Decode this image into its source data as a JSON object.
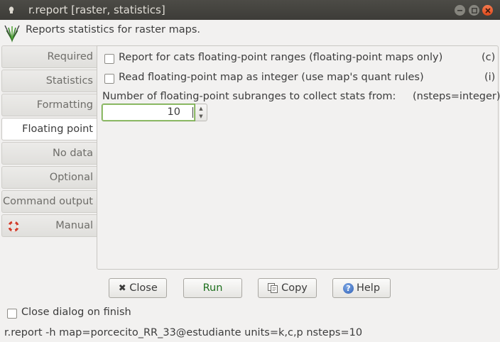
{
  "window": {
    "title": "r.report [raster, statistics]"
  },
  "header": {
    "description": "Reports statistics for raster maps."
  },
  "tabs": [
    {
      "label": "Required"
    },
    {
      "label": "Statistics"
    },
    {
      "label": "Formatting"
    },
    {
      "label": "Floating point",
      "active": true
    },
    {
      "label": "No data"
    },
    {
      "label": "Optional"
    },
    {
      "label": "Command output"
    },
    {
      "label": "Manual"
    }
  ],
  "options": {
    "cats_ranges": {
      "label": "Report for cats floating-point ranges (floating-point maps only)",
      "flag": "(c)",
      "checked": false
    },
    "read_integer": {
      "label": "Read floating-point map as integer (use map's quant rules)",
      "flag": "(i)",
      "checked": false
    },
    "nsteps": {
      "label": "Number of floating-point subranges to collect stats from:",
      "type_hint": "(nsteps=integer)",
      "value": "10"
    }
  },
  "buttons": {
    "close": "Close",
    "run": "Run",
    "copy": "Copy",
    "help": "Help"
  },
  "close_on_finish": {
    "label": "Close dialog on finish",
    "checked": false
  },
  "status": {
    "command": "r.report -h map=porcecito_RR_33@estudiante units=k,c,p nsteps=10"
  },
  "icons": {
    "window": "grass-window-icon",
    "logo": "grass-logo-icon",
    "manual": "lifebuoy-icon",
    "close_button": "close-x-icon",
    "copy_button": "copy-icon",
    "help_button": "help-icon"
  },
  "colors": {
    "titlebar": "#3d3c38",
    "close_window_button": "#df4a1c",
    "run_text": "#1d6f1d",
    "focus_border": "#6ba03f"
  }
}
